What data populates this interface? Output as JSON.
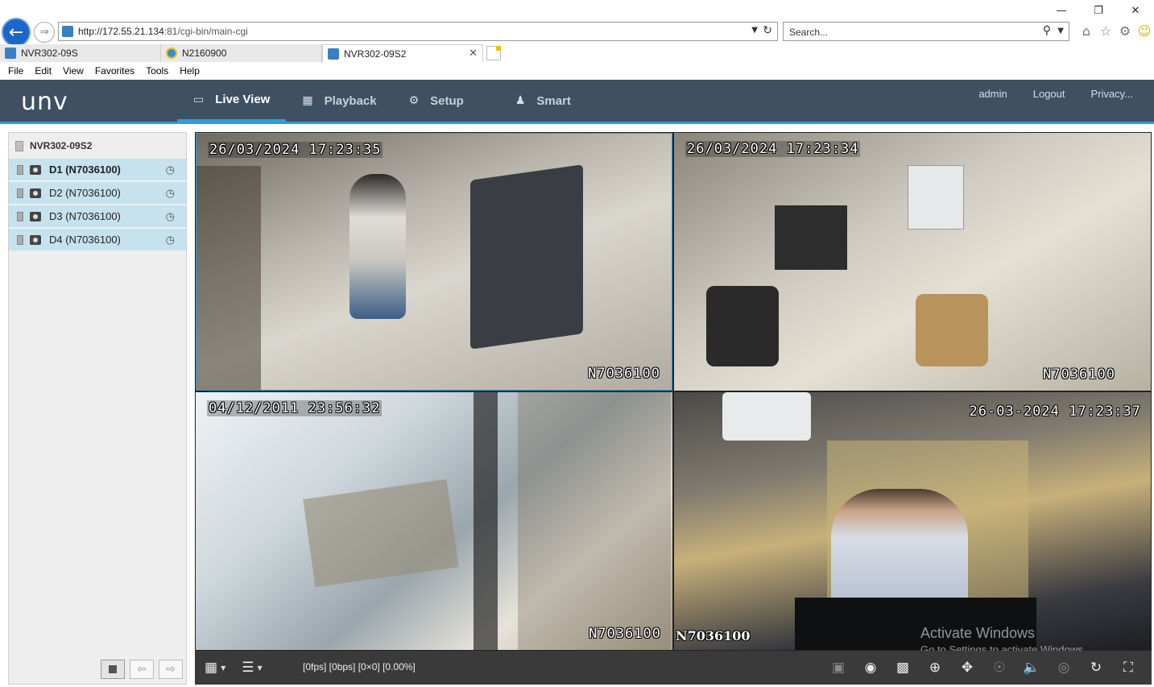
{
  "window": {
    "minimize_icon": "minimize-icon",
    "restore_icon": "restore-icon",
    "close_icon": "close-icon"
  },
  "browser": {
    "address": {
      "host": "http://172.55.21.134",
      "rest": ":81/cgi-bin/main-cgi"
    },
    "search_placeholder": "Search...",
    "tabs": [
      {
        "label": "NVR302-09S"
      },
      {
        "label": "N2160900"
      },
      {
        "label": "NVR302-09S2"
      }
    ],
    "menu": [
      "File",
      "Edit",
      "View",
      "Favorites",
      "Tools",
      "Help"
    ]
  },
  "app": {
    "logo": "unv",
    "nav": [
      {
        "label": "Live View",
        "icon": "monitor-icon"
      },
      {
        "label": "Playback",
        "icon": "film-icon"
      },
      {
        "label": "Setup",
        "icon": "gear-icon"
      },
      {
        "label": "Smart",
        "icon": "person-icon"
      }
    ],
    "user_links": [
      "admin",
      "Logout",
      "Privacy..."
    ],
    "accent_color": "#2a9fd6",
    "header_color": "#3e5062"
  },
  "tree": {
    "root": "NVR302-09S2",
    "channels": [
      {
        "label": "D1 (N7036100)",
        "selected": true
      },
      {
        "label": "D2 (N7036100)",
        "selected": false
      },
      {
        "label": "D3 (N7036100)",
        "selected": false
      },
      {
        "label": "D4 (N7036100)",
        "selected": false
      }
    ]
  },
  "tiles": [
    {
      "timestamp": "26/03/2024 17:23:35",
      "camera": "N7036100"
    },
    {
      "timestamp": "26/03/2024 17:23:34",
      "camera": "N7036100"
    },
    {
      "timestamp": "04/12/2011 23:56:32",
      "camera": "N7036100"
    },
    {
      "timestamp": "26-03-2024 17:23:37",
      "camera": "N7036100"
    }
  ],
  "toolbar": {
    "status": "[0fps] [0bps] [0×0] [0.00%]"
  },
  "watermark": {
    "title": "Activate Windows",
    "subtitle": "Go to Settings to activate Windows."
  }
}
